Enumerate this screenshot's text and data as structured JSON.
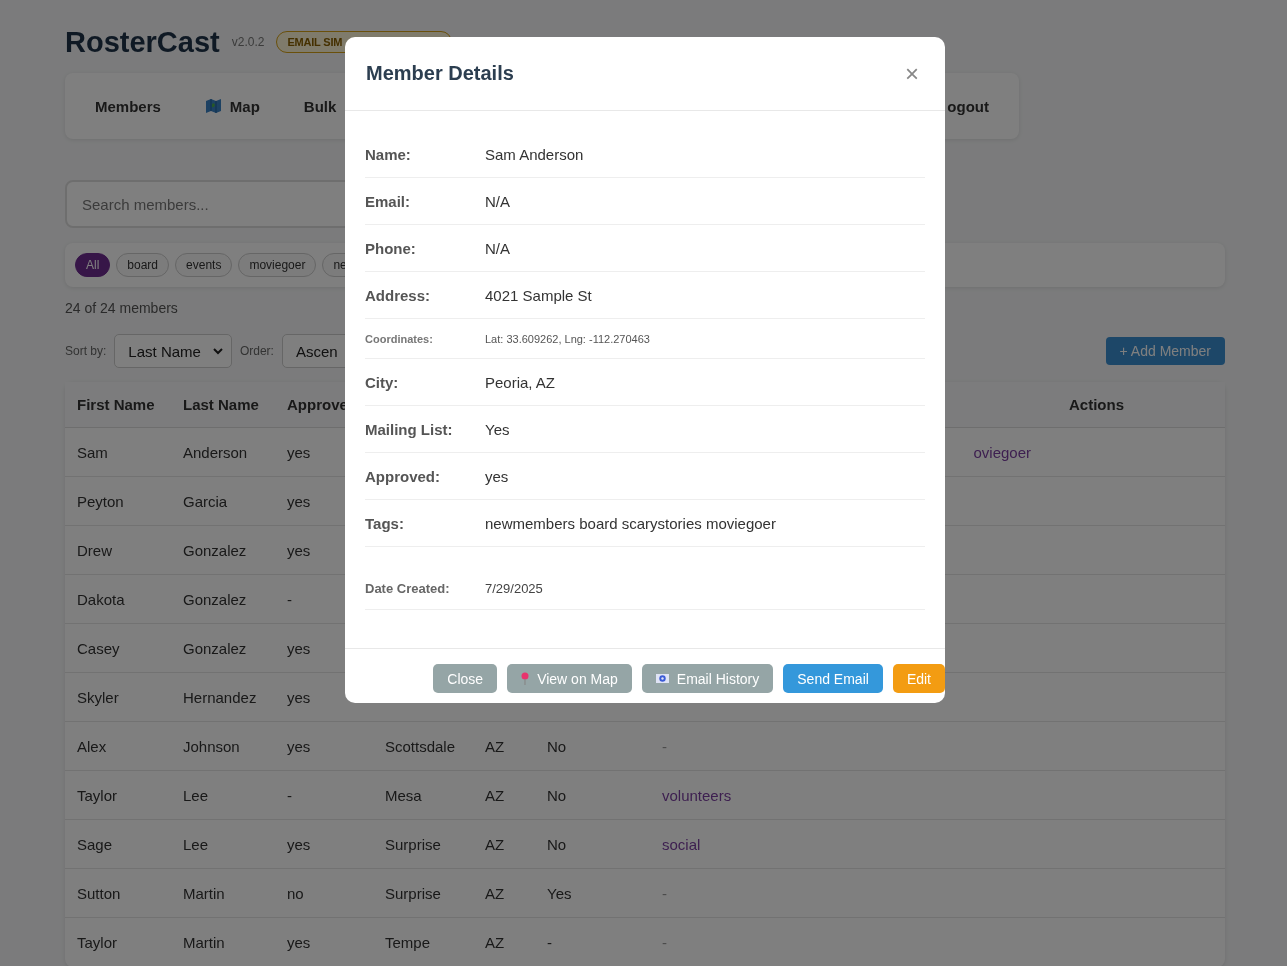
{
  "app": {
    "title": "RosterCast",
    "version": "v2.0.2",
    "badge": "EMAIL SIM"
  },
  "nav": [
    {
      "label": "Members",
      "kind": "plain"
    },
    {
      "label": "Map",
      "kind": "map"
    },
    {
      "label": "Bulk",
      "kind": "plain"
    },
    {
      "label": "ogout",
      "kind": "plain"
    }
  ],
  "search": {
    "placeholder": "Search members..."
  },
  "tag_filters": [
    {
      "label": "All",
      "selected": true
    },
    {
      "label": "board",
      "selected": false
    },
    {
      "label": "events",
      "selected": false
    },
    {
      "label": "moviegoer",
      "selected": false
    },
    {
      "label": "ne",
      "selected": false
    }
  ],
  "count": "24 of 24 members",
  "sort": {
    "sort_label": "Sort by:",
    "sort_value": "Last Name",
    "order_label": "Order:",
    "order_value": "Ascen"
  },
  "add_button": "+ Add Member",
  "table": {
    "columns": [
      "First Name",
      "Last Name",
      "Approve",
      "",
      "",
      "",
      "",
      "Actions"
    ],
    "rows": [
      {
        "first": "Sam",
        "last": "Anderson",
        "approved": "yes",
        "tags": {
          "text": "oviegoer",
          "kind": "link"
        }
      },
      {
        "first": "Peyton",
        "last": "Garcia",
        "approved": "yes"
      },
      {
        "first": "Drew",
        "last": "Gonzalez",
        "approved": "yes"
      },
      {
        "first": "Dakota",
        "last": "Gonzalez",
        "approved": "-"
      },
      {
        "first": "Casey",
        "last": "Gonzalez",
        "approved": "yes"
      },
      {
        "first": "Skyler",
        "last": "Hernandez",
        "approved": "yes"
      },
      {
        "first": "Alex",
        "last": "Johnson",
        "approved": "yes",
        "city": "Scottsdale",
        "state": "AZ",
        "mailing": "No",
        "tags": {
          "text": "-",
          "kind": "empty"
        }
      },
      {
        "first": "Taylor",
        "last": "Lee",
        "approved": "-",
        "city": "Mesa",
        "state": "AZ",
        "mailing": "No",
        "tags": {
          "text": "volunteers",
          "kind": "link"
        }
      },
      {
        "first": "Sage",
        "last": "Lee",
        "approved": "yes",
        "city": "Surprise",
        "state": "AZ",
        "mailing": "No",
        "tags": {
          "text": "social",
          "kind": "link"
        }
      },
      {
        "first": "Sutton",
        "last": "Martin",
        "approved": "no",
        "city": "Surprise",
        "state": "AZ",
        "mailing": "Yes",
        "tags": {
          "text": "-",
          "kind": "empty"
        }
      },
      {
        "first": "Taylor",
        "last": "Martin",
        "approved": "yes",
        "city": "Tempe",
        "state": "AZ",
        "mailing": "-",
        "tags": {
          "text": "-",
          "kind": "empty"
        }
      }
    ]
  },
  "modal": {
    "title": "Member Details",
    "close": "×",
    "fields": [
      {
        "label": "Name:",
        "value": "Sam Anderson",
        "kind": "normal"
      },
      {
        "label": "Email:",
        "value": "N/A",
        "kind": "normal"
      },
      {
        "label": "Phone:",
        "value": "N/A",
        "kind": "normal"
      },
      {
        "label": "Address:",
        "value": "4021 Sample St",
        "kind": "normal"
      },
      {
        "label": "Coordinates:",
        "value": "Lat: 33.609262, Lng: -112.270463",
        "kind": "small"
      },
      {
        "label": "City:",
        "value": "Peoria, AZ",
        "kind": "normal"
      },
      {
        "label": "Mailing List:",
        "value": "Yes",
        "kind": "normal"
      },
      {
        "label": "Approved:",
        "value": "yes",
        "kind": "normal"
      },
      {
        "label": "Tags:",
        "value": "newmembers board scarystories moviegoer",
        "kind": "normal"
      },
      {
        "label": "Date Created:",
        "value": "7/29/2025",
        "kind": "meta"
      }
    ],
    "buttons": [
      {
        "label": "Close",
        "kind": "close"
      },
      {
        "label": "View on Map",
        "kind": "map"
      },
      {
        "label": "Email History",
        "kind": "history"
      },
      {
        "label": "Send Email",
        "kind": "send"
      },
      {
        "label": "Edit",
        "kind": "edit"
      }
    ]
  }
}
